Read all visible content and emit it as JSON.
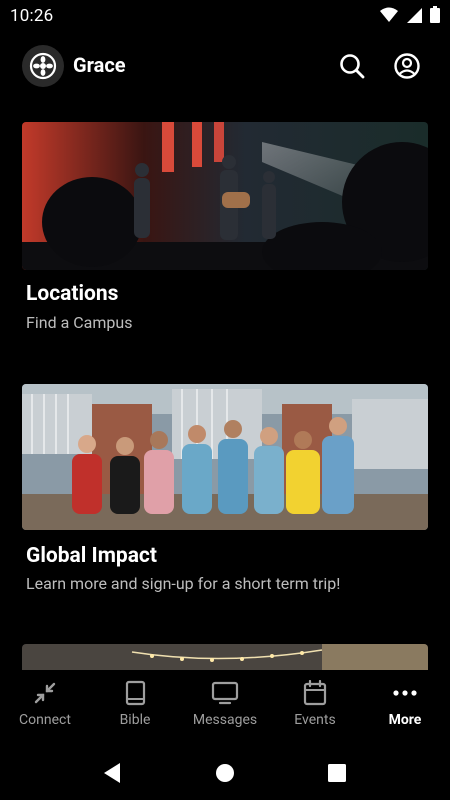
{
  "status": {
    "time": "10:26"
  },
  "app": {
    "title": "Grace"
  },
  "cards": [
    {
      "title": "Locations",
      "subtitle": "Find a Campus"
    },
    {
      "title": "Global Impact",
      "subtitle": "Learn more and sign-up for a short term trip!"
    }
  ],
  "tabs": [
    {
      "label": "Connect",
      "icon": "connect-icon",
      "active": false
    },
    {
      "label": "Bible",
      "icon": "book-icon",
      "active": false
    },
    {
      "label": "Messages",
      "icon": "tv-icon",
      "active": false
    },
    {
      "label": "Events",
      "icon": "calendar-icon",
      "active": false
    },
    {
      "label": "More",
      "icon": "more-icon",
      "active": true
    }
  ],
  "colors": {
    "background": "#000000",
    "inactive": "#9e9e9e",
    "active": "#ffffff",
    "subtitle": "#bdbdbd"
  }
}
